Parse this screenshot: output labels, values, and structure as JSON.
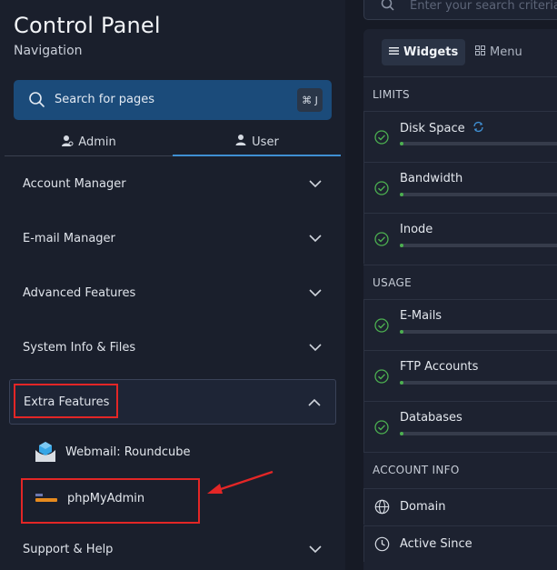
{
  "sidebar": {
    "title": "Control Panel",
    "subtitle": "Navigation",
    "search": {
      "placeholder": "Search for pages",
      "shortcut": "⌘ J"
    },
    "tabs": [
      {
        "label": "Admin"
      },
      {
        "label": "User"
      }
    ],
    "items": [
      {
        "label": "Account Manager"
      },
      {
        "label": "E-mail Manager"
      },
      {
        "label": "Advanced Features"
      },
      {
        "label": "System Info & Files"
      },
      {
        "label": "Extra Features"
      },
      {
        "label": "Support & Help"
      }
    ],
    "extra_sub": [
      {
        "label": "Webmail: Roundcube"
      },
      {
        "label": "phpMyAdmin"
      }
    ]
  },
  "right": {
    "search_placeholder": "Enter your search criteria",
    "tabs": [
      {
        "label": "Widgets"
      },
      {
        "label": "Menu"
      }
    ],
    "sections": {
      "limits": "LIMITS",
      "usage": "USAGE",
      "account_info": "ACCOUNT INFO"
    },
    "limits": [
      {
        "label": "Disk Space"
      },
      {
        "label": "Bandwidth"
      },
      {
        "label": "Inode"
      }
    ],
    "usage": [
      {
        "label": "E-Mails"
      },
      {
        "label": "FTP Accounts"
      },
      {
        "label": "Databases"
      }
    ],
    "account_info": [
      {
        "label": "Domain"
      },
      {
        "label": "Active Since"
      }
    ]
  },
  "colors": {
    "accent": "#3f8fd2",
    "highlight": "#e32626",
    "ok": "#4caf50"
  }
}
